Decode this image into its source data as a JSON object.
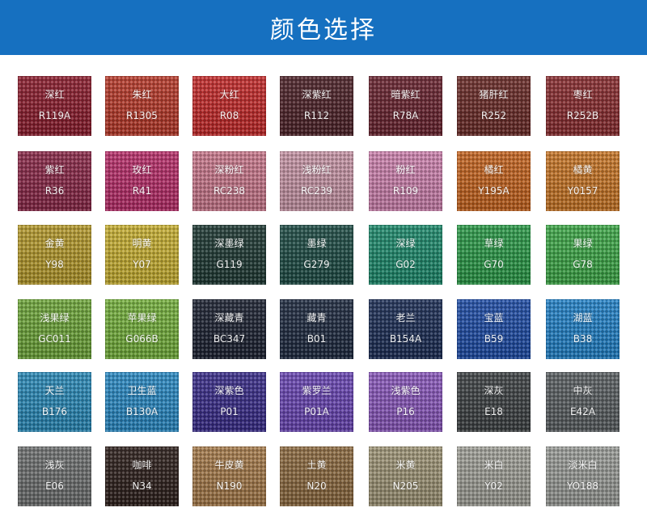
{
  "header": {
    "title": "颜色选择"
  },
  "swatches": [
    {
      "name": "深红",
      "code": "R119A",
      "color": "#8c1d2e"
    },
    {
      "name": "朱红",
      "code": "R1305",
      "color": "#b83a2a"
    },
    {
      "name": "大红",
      "code": "R08",
      "color": "#c42a2a"
    },
    {
      "name": "深紫红",
      "code": "R112",
      "color": "#4e2329"
    },
    {
      "name": "暗紫红",
      "code": "R78A",
      "color": "#6a2430"
    },
    {
      "name": "猪肝红",
      "code": "R252",
      "color": "#6b2c28"
    },
    {
      "name": "枣红",
      "code": "R252B",
      "color": "#8a2d30"
    },
    {
      "name": "紫红",
      "code": "R36",
      "color": "#8a2848"
    },
    {
      "name": "玫红",
      "code": "R41",
      "color": "#b82e6a"
    },
    {
      "name": "深粉红",
      "code": "RC238",
      "color": "#c9788c"
    },
    {
      "name": "浅粉红",
      "code": "RC239",
      "color": "#c795a6"
    },
    {
      "name": "粉红",
      "code": "R109",
      "color": "#cd82ae"
    },
    {
      "name": "橘红",
      "code": "Y195A",
      "color": "#c5641f"
    },
    {
      "name": "橘黄",
      "code": "Y0157",
      "color": "#c87626"
    },
    {
      "name": "金黄",
      "code": "Y98",
      "color": "#b59a2c"
    },
    {
      "name": "明黄",
      "code": "Y07",
      "color": "#c8b032"
    },
    {
      "name": "深墨绿",
      "code": "G119",
      "color": "#1f3a34"
    },
    {
      "name": "墨绿",
      "code": "G279",
      "color": "#1e4c45"
    },
    {
      "name": "深绿",
      "code": "G02",
      "color": "#1d8a6c"
    },
    {
      "name": "草绿",
      "code": "G70",
      "color": "#2b9a48"
    },
    {
      "name": "果绿",
      "code": "G78",
      "color": "#3ea848"
    },
    {
      "name": "浅果绿",
      "code": "GC011",
      "color": "#6ea63a"
    },
    {
      "name": "苹果绿",
      "code": "G066B",
      "color": "#74b03c"
    },
    {
      "name": "深藏青",
      "code": "BC347",
      "color": "#1c2232"
    },
    {
      "name": "藏青",
      "code": "B01",
      "color": "#1e2a40"
    },
    {
      "name": "老兰",
      "code": "B154A",
      "color": "#1c2e56"
    },
    {
      "name": "宝蓝",
      "code": "B59",
      "color": "#1e4ca6"
    },
    {
      "name": "湖蓝",
      "code": "B38",
      "color": "#2282c8"
    },
    {
      "name": "天兰",
      "code": "B176",
      "color": "#2a8ab8"
    },
    {
      "name": "卫生蓝",
      "code": "B130A",
      "color": "#2a8ac4"
    },
    {
      "name": "深紫色",
      "code": "P01",
      "color": "#3a2d8a"
    },
    {
      "name": "紫罗兰",
      "code": "P01A",
      "color": "#6a46b4"
    },
    {
      "name": "浅紫色",
      "code": "P16",
      "color": "#8a58bc"
    },
    {
      "name": "深灰",
      "code": "E18",
      "color": "#3e4244"
    },
    {
      "name": "中灰",
      "code": "E42A",
      "color": "#5a5f62"
    },
    {
      "name": "浅灰",
      "code": "E06",
      "color": "#6e7070"
    },
    {
      "name": "咖啡",
      "code": "N34",
      "color": "#2e201c"
    },
    {
      "name": "牛皮黄",
      "code": "N190",
      "color": "#a57a4a"
    },
    {
      "name": "土黄",
      "code": "N20",
      "color": "#8c6a40"
    },
    {
      "name": "米黄",
      "code": "N205",
      "color": "#9e9476"
    },
    {
      "name": "米白",
      "code": "Y02",
      "color": "#a0a098"
    },
    {
      "name": "淡米白",
      "code": "YO188",
      "color": "#9a9c98"
    }
  ]
}
